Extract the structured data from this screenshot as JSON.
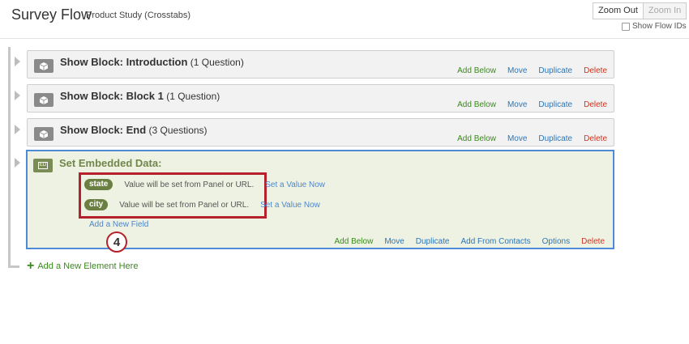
{
  "header": {
    "title": "Survey Flow",
    "subtitle": "Product Study (Crosstabs)",
    "zoom_out": "Zoom Out",
    "zoom_in": "Zoom In",
    "show_flow_ids": "Show Flow IDs"
  },
  "blocks": [
    {
      "title": "Show Block: Introduction",
      "detail": "(1 Question)"
    },
    {
      "title": "Show Block: Block 1",
      "detail": "(1 Question)"
    },
    {
      "title": "Show Block: End",
      "detail": "(3 Questions)"
    }
  ],
  "block_actions": {
    "add_below": "Add Below",
    "move": "Move",
    "duplicate": "Duplicate",
    "delete": "Delete"
  },
  "embedded": {
    "icon_text": "ED",
    "title": "Set Embedded Data:",
    "fields": [
      {
        "name": "state",
        "value": "Value will be set from Panel or URL.",
        "link": "Set a Value Now"
      },
      {
        "name": "city",
        "value": "Value will be set from Panel or URL.",
        "link": "Set a Value Now"
      }
    ],
    "add_field": "Add a New Field",
    "actions": {
      "add_below": "Add Below",
      "move": "Move",
      "duplicate": "Duplicate",
      "add_from_contacts": "Add From Contacts",
      "options": "Options",
      "delete": "Delete"
    }
  },
  "step_badge": "4",
  "add_element": "Add a New Element Here",
  "colors": {
    "green_action": "#3a8a1d",
    "blue_action": "#2a76b9",
    "red_action": "#d0331e",
    "embedded_bg": "#eef2e3",
    "embedded_border": "#4f8ad6",
    "highlight": "#b6222b"
  }
}
